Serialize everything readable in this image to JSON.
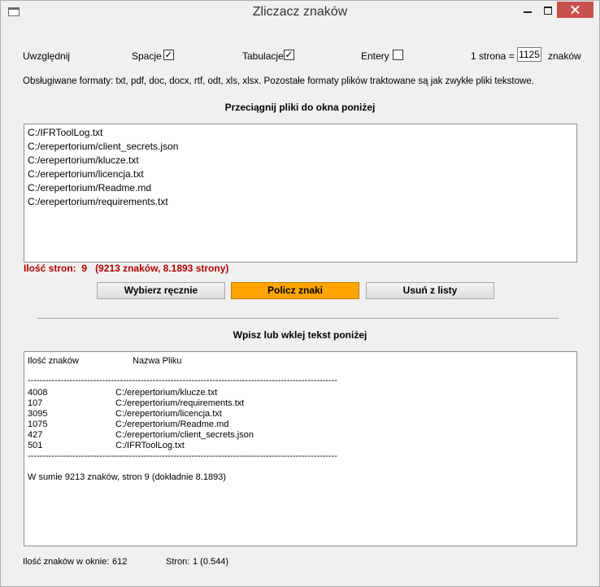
{
  "window": {
    "title": "Zliczacz znaków"
  },
  "options": {
    "include_label": "Uwzględnij",
    "spaces_label": "Spacje",
    "spaces_checked": true,
    "tabs_label": "Tabulacje",
    "tabs_checked": true,
    "enters_label": "Entery",
    "enters_checked": false,
    "page_prefix": "1 strona =",
    "page_value": "1125",
    "page_suffix": "znaków"
  },
  "formats_note": "Obsługiwane formaty: txt, pdf, doc, docx, rtf, odt, xls, xlsx. Pozostałe formaty plików traktowane są jak zwykłe pliki tekstowe.",
  "drop_heading": "Przeciągnij pliki do okna poniżej",
  "files": [
    "C:/IFRToolLog.txt",
    "C:/erepertorium/client_secrets.json",
    "C:/erepertorium/klucze.txt",
    "C:/erepertorium/licencja.txt",
    "C:/erepertorium/Readme.md",
    "C:/erepertorium/requirements.txt"
  ],
  "result": {
    "label": "Ilość stron:",
    "pages": "9",
    "detail": "(9213 znaków, 8.1893 strony)"
  },
  "buttons": {
    "choose": "Wybierz ręcznie",
    "count": "Policz znaki",
    "remove": "Usuń z listy"
  },
  "text_heading": "Wpisz lub wklej tekst poniżej",
  "text_area": {
    "col1_header": "Ilość znaków",
    "col2_header": "Nazwa Pliku",
    "separator": "--------------------------------------------------------------------------------------------------------",
    "rows": [
      {
        "count": "4008",
        "file": "C:/erepertorium/klucze.txt"
      },
      {
        "count": "107",
        "file": "C:/erepertorium/requirements.txt"
      },
      {
        "count": "3095",
        "file": "C:/erepertorium/licencja.txt"
      },
      {
        "count": "1075",
        "file": "C:/erepertorium/Readme.md"
      },
      {
        "count": "427",
        "file": "C:/erepertorium/client_secrets.json"
      },
      {
        "count": "501",
        "file": "C:/IFRToolLog.txt"
      }
    ],
    "summary": "W sumie 9213 znaków, stron 9 (dokładnie 8.1893)"
  },
  "status": {
    "chars_label": "Ilość znaków w oknie:",
    "chars_value": "612",
    "pages_label": "Stron:",
    "pages_value": "1 (0.544)"
  }
}
